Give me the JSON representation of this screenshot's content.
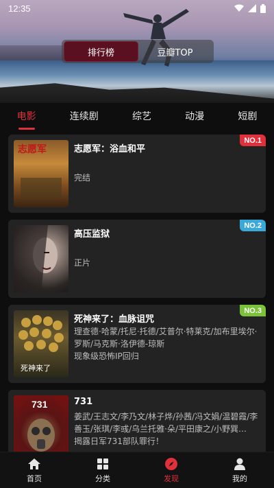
{
  "status_bar": {
    "time": "12:35"
  },
  "hero": {
    "segments": [
      "排行榜",
      "豆瓣TOP"
    ],
    "active_segment": 0
  },
  "tabs": [
    "电影",
    "连续剧",
    "综艺",
    "动漫",
    "短剧"
  ],
  "active_tab": 0,
  "items": [
    {
      "title": "志愿军：浴血和平",
      "subtitle": "",
      "status": "完结",
      "rank": "NO.1",
      "badge_color": "#e0303c",
      "poster_text": "志愿军"
    },
    {
      "title": "高压监狱",
      "subtitle": "",
      "status": "正片",
      "rank": "NO.2",
      "badge_color": "#3aa8d8"
    },
    {
      "title": "死神来了：血脉诅咒",
      "subtitle": "理查德·哈蒙/托尼·托德/艾普尔·特莱克/加布里埃尔·罗斯/马克斯·洛伊德-琼斯",
      "status": "现象级恐怖IP回归",
      "rank": "NO.3",
      "badge_color": "#7bc23a",
      "poster_text": "死神来了"
    },
    {
      "title": "731",
      "subtitle": "姜武/王志文/李乃文/林子烨/孙茜/冯文娟/温碧霞/李善玉/张琪/李彧/乌兰托雅·朵/平田康之/小野巽…",
      "status": "揭露日军731部队罪行！",
      "rank": "",
      "badge_color": "#e0303c",
      "poster_text": "731"
    }
  ],
  "bottom_nav": [
    "首页",
    "分类",
    "发现",
    "我的"
  ],
  "active_nav": 2,
  "colors": {
    "accent": "#e0303c",
    "card_bg": "#232323",
    "background": "#0e0e0e"
  }
}
